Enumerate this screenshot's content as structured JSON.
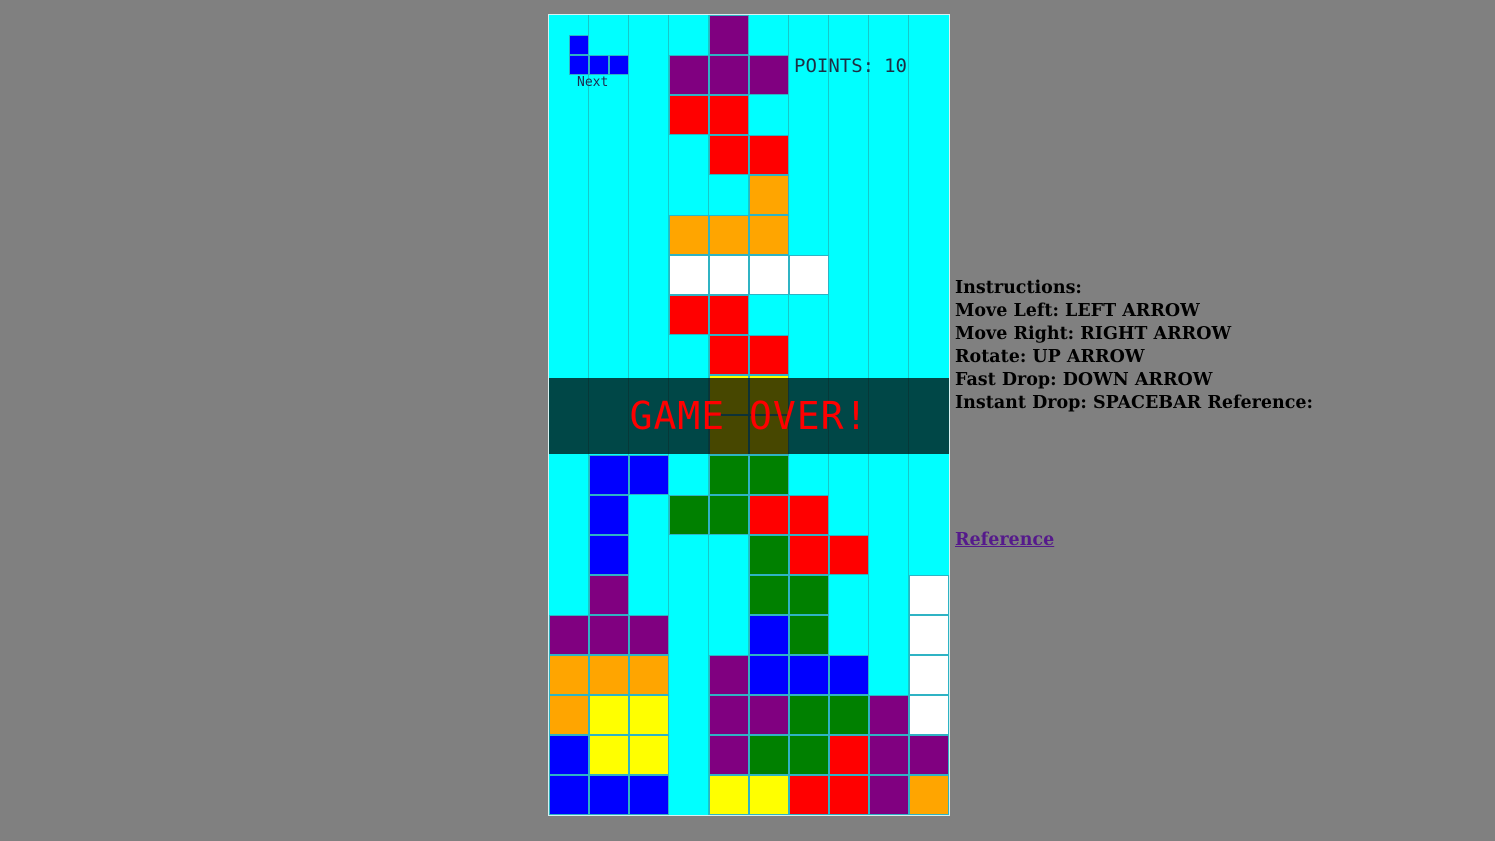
{
  "game": {
    "points_label": "POINTS:",
    "points": "10",
    "next_label": "Next",
    "game_over_text": "GAME OVER!",
    "colors": {
      "board_bg": "#00ffff",
      "P": "#800080",
      "R": "#ff0000",
      "O": "#ffa500",
      "W": "#ffffff",
      "G": "#008000",
      "B": "#0000ff",
      "Y": "#ffff00"
    },
    "next_piece": [
      "B..",
      "BBB"
    ],
    "board": [
      "....P.....",
      "...PPP....",
      "...RR.....",
      "....RR....",
      ".....O....",
      "...OOO....",
      "...WWWW...",
      "...RR.....",
      "....RR....",
      "....YY....",
      "....YY....",
      ".BB.GG....",
      ".B.GGRR...",
      ".B...GRR..",
      ".P...GG..W",
      "PPP..BG..W",
      "OOO.PBBB.W",
      "OYY.PPGGPW",
      "BYY.PGGRPP",
      "BBB.YYRRPO"
    ]
  },
  "instructions": {
    "title": "Instructions:",
    "lines": {
      "move_left": "Move Left: LEFT ARROW",
      "move_right": "Move Right: RIGHT ARROW",
      "rotate": "Rotate: UP ARROW",
      "fast_drop": "Fast Drop: DOWN ARROW",
      "instant_drop": "Instant Drop: SPACEBAR Reference:"
    }
  },
  "reference_link": "Reference"
}
